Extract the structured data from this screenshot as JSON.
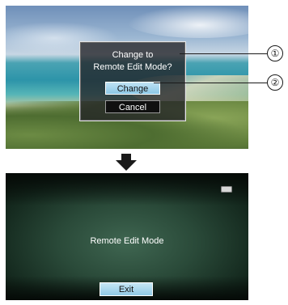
{
  "top_panel": {
    "dialog": {
      "title_line1": "Change to",
      "title_line2": "Remote Edit Mode?",
      "change_label": "Change",
      "cancel_label": "Cancel"
    }
  },
  "callouts": {
    "one": "①",
    "two": "②"
  },
  "arrow": {
    "icon": "down-arrow-icon"
  },
  "bottom_panel": {
    "title": "Remote Edit Mode",
    "exit_label": "Exit",
    "status_icon": "battery-icon"
  },
  "colors": {
    "selected_button": "#8cc7e6",
    "dialog_bg": "#232326",
    "screen_bg": "#2a4a39"
  }
}
